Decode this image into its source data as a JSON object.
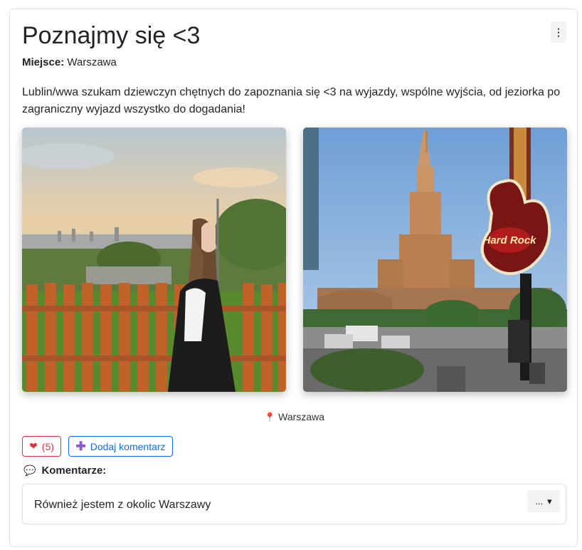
{
  "post": {
    "title": "Poznajmy się <3",
    "menu_icon": "⋮",
    "place_label": "Miejsce:",
    "place_value": "Warszawa",
    "description": "Lublin/wwa szukam dziewczyn chętnych do zapoznania się <3 na wyjazdy, wspólne wyjścia, od jeziorka po zagraniczny wyjazd wszystko do dogadania!",
    "location_icon": "📍",
    "location": "Warszawa"
  },
  "actions": {
    "like_icon": "❤",
    "like_count": "(5)",
    "add_comment_icon": "✚",
    "add_comment_label": "Dodaj komentarz"
  },
  "comments": {
    "header_icon": "💬",
    "header": "Komentarze:",
    "items": [
      {
        "text": "Również jestem z okolic Warszawy",
        "menu_label": "...",
        "menu_caret": "▾"
      }
    ]
  },
  "colors": {
    "like": "#dc3545",
    "primary": "#0d6efd"
  }
}
